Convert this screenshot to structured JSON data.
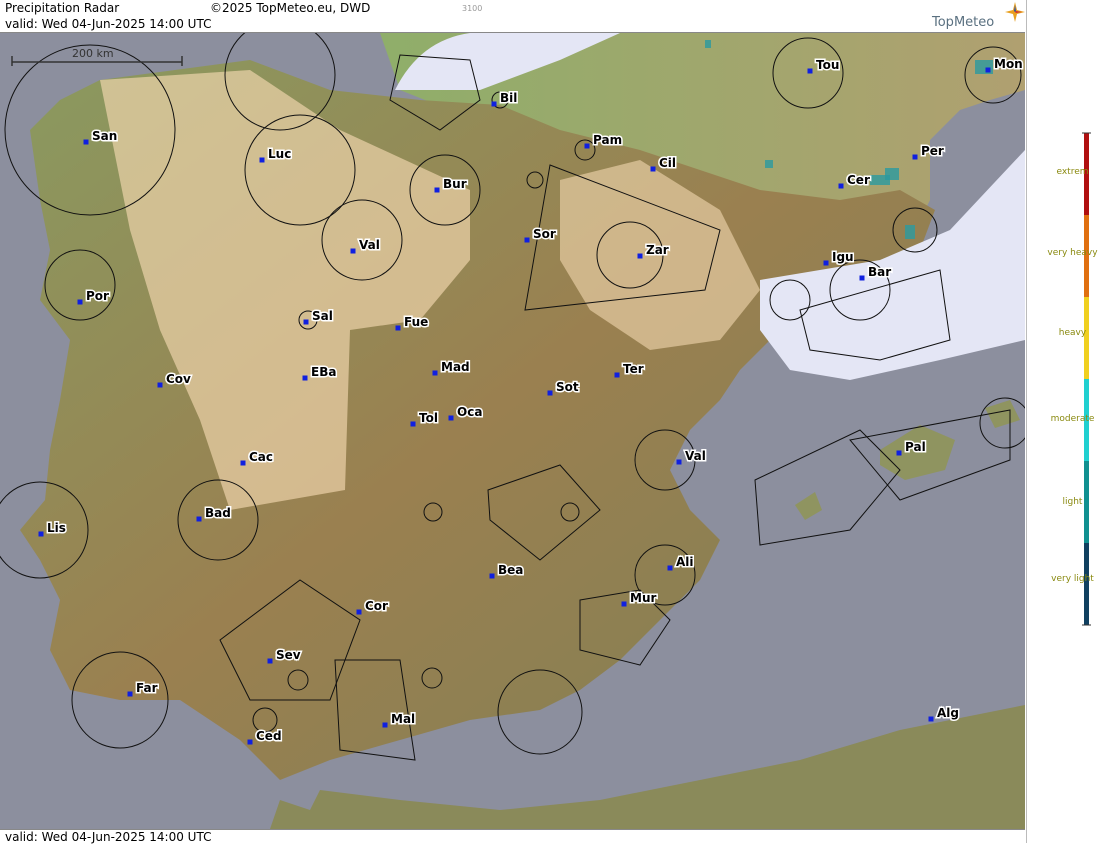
{
  "header": {
    "title": "Precipitation Radar",
    "copyright": "©2025 TopMeteo.eu, DWD",
    "code": "3100",
    "valid": "valid:  Wed  04-Jun-2025 14:00 UTC",
    "logo": "TopMeteo"
  },
  "footer": {
    "valid": "valid:  Wed  04-Jun-2025 14:00 UTC"
  },
  "scale": {
    "label": "200 km"
  },
  "legend": {
    "levels": [
      "extrem",
      "very heavy",
      "heavy",
      "moderate",
      "light",
      "very light"
    ],
    "colors": [
      "#b01010",
      "#e07010",
      "#f0d020",
      "#20d0d0",
      "#109090",
      "#104060"
    ]
  },
  "cities": [
    {
      "name": "San"
    },
    {
      "name": "Luc"
    },
    {
      "name": "Bur"
    },
    {
      "name": "Bil"
    },
    {
      "name": "Pam"
    },
    {
      "name": "Tou"
    },
    {
      "name": "Mon"
    },
    {
      "name": "Per"
    },
    {
      "name": "Cil"
    },
    {
      "name": "Cer"
    },
    {
      "name": "Por"
    },
    {
      "name": "Val"
    },
    {
      "name": "Sor"
    },
    {
      "name": "Zar"
    },
    {
      "name": "Igu"
    },
    {
      "name": "Bar"
    },
    {
      "name": "Sal"
    },
    {
      "name": "Fue"
    },
    {
      "name": "Mad"
    },
    {
      "name": "Cov"
    },
    {
      "name": "EBa"
    },
    {
      "name": "Sot"
    },
    {
      "name": "Ter"
    },
    {
      "name": "Tol"
    },
    {
      "name": "Oca"
    },
    {
      "name": "Cac"
    },
    {
      "name": "Val"
    },
    {
      "name": "Pal"
    },
    {
      "name": "Lis"
    },
    {
      "name": "Bad"
    },
    {
      "name": "Bea"
    },
    {
      "name": "Ali"
    },
    {
      "name": "Cor"
    },
    {
      "name": "Mur"
    },
    {
      "name": "Sev"
    },
    {
      "name": "Far"
    },
    {
      "name": "Mal"
    },
    {
      "name": "Ced"
    },
    {
      "name": "Alg"
    }
  ]
}
